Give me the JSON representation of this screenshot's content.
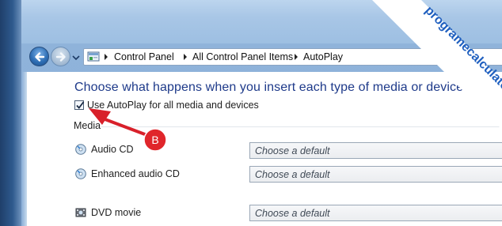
{
  "address_bar": {
    "crumbs": [
      "Control Panel",
      "All Control Panel Items",
      "AutoPlay"
    ]
  },
  "main": {
    "heading": "Choose what happens when you insert each type of media or device",
    "checkbox_label": "Use AutoPlay for all media and devices",
    "checkbox_checked": true,
    "section_media": "Media",
    "rows": [
      {
        "label": "Audio CD",
        "icon": "audio-cd-icon",
        "select_value": "Choose a default"
      },
      {
        "label": "Enhanced audio CD",
        "icon": "audio-cd-icon",
        "select_value": "Choose a default"
      },
      {
        "label": "DVD movie",
        "icon": "dvd-movie-icon",
        "select_value": "Choose a default"
      }
    ]
  },
  "annotation": {
    "marker_text": "B",
    "marker_color": "#e0262b"
  },
  "watermark": {
    "text": "programecalculator.ro"
  },
  "colors": {
    "heading": "#1e3a8a",
    "frame": "#8fb3da"
  }
}
